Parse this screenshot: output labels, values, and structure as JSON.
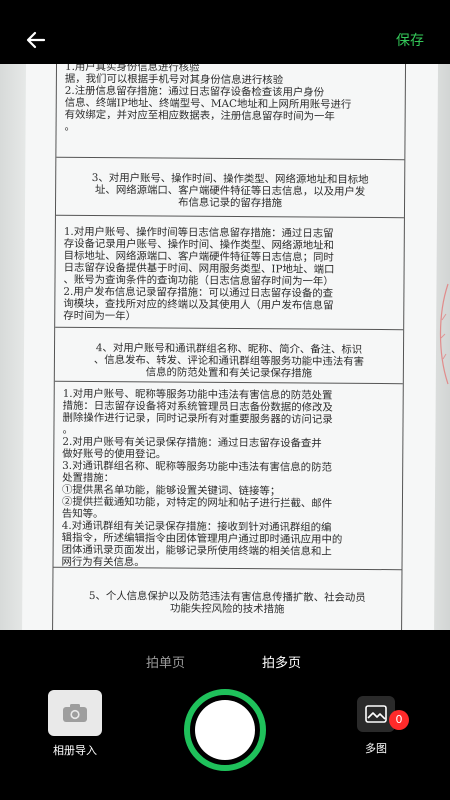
{
  "header": {
    "save_label": "保存"
  },
  "document": {
    "rows": [
      {
        "text": "1.用户真实身份信息进行核验\n据，我们可以根据手机号对其身份信息进行核验\n2.注册信息留存措施：通过日志留存设备检查该用户身份\n信息、终端IP地址、终端型号、MAC地址和上网所用账号进行\n有效绑定，并对应至相应数据表，注册信息留存时间为一年\n。"
      },
      {
        "text": "3、对用户账号、操作时间、操作类型、网络源地址和目标地\n址、网络源端口、客户端硬件特征等日志信息，以及用户发\n布信息记录的留存措施"
      },
      {
        "text": "1.对用户账号、操作时间等日志信息留存措施：通过日志留\n存设备记录用户账号、操作时间、操作类型、网络源地址和\n目标地址、网络源端口、客户端硬件特征等日志信息；同时\n日志留存设备提供基于时间、网用服务类型、IP地址、端口\n、账号为查询条件的查询功能（日志信息留存时间为一年）\n2.用户发布信息记录留存措施：可以通过日志留存设备的查\n询模块，查找所对应的终端以及其使用人（用户发布信息留\n存时间为一年）"
      },
      {
        "text": "4、对用户账号和通讯群组名称、昵称、简介、备注、标识\n、信息发布、转发、评论和通讯群组等服务功能中违法有害\n信息的防范处置和有关记录保存措施"
      },
      {
        "text": "1.对用户账号、昵称等服务功能中违法有害信息的防范处置\n措施：日志留存设备将对系统管理员日志备份数据的修改及\n删除操作进行记录，同时记录所有对重要服务器的访问记录\n。\n2.对用户账号有关记录保存措施：通过日志留存设备查并\n做好账号的使用登记。\n3.对通讯群组名称、昵称等服务功能中违法有害信息的防范\n处置措施：\n①提供黑名单功能，能够设置关键词、链接等；\n②提供拦截通知功能，对特定的网址和帖子进行拦截、邮件\n告知等。\n4.对通讯群组有关记录保存措施：接收到针对通讯群组的编\n辑指令，所述编辑指令由团体管理用户通过即时通讯应用中的\n团体通讯录页面发出，能够记录所使用终端的相关信息和上\n网行为有关信息。"
      },
      {
        "text": "5、个人信息保护以及防范违法有害信息传播扩散、社会动员\n功能失控风险的技术措施"
      }
    ]
  },
  "modes": {
    "single_label": "拍单页",
    "multi_label": "拍多页"
  },
  "album": {
    "label": "相册导入"
  },
  "multi": {
    "label": "多图",
    "count": "0"
  },
  "colors": {
    "accent": "#1fc15b",
    "save": "#34c759",
    "badge": "#ff2a2a"
  }
}
